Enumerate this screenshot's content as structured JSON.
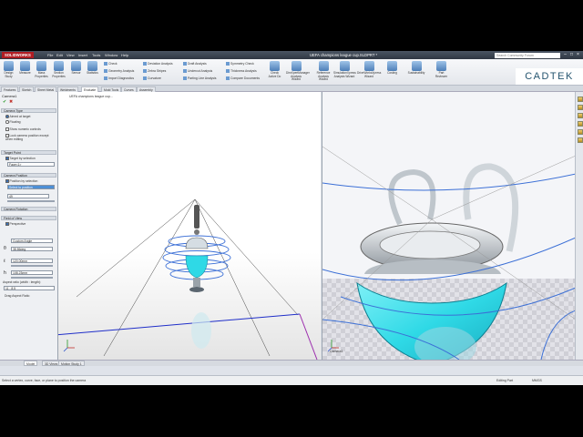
{
  "app": {
    "logo": "SOLIDWORKS",
    "document_title": "UEFA champions league cup.SLDPRT *"
  },
  "menu": [
    "File",
    "Edit",
    "View",
    "Insert",
    "Tools",
    "Window",
    "Help"
  ],
  "search": {
    "placeholder": "Search Community Forum"
  },
  "brand": {
    "logo_text": "CADTEK",
    "accent_color": "#24546f"
  },
  "ribbon": {
    "big_tools": [
      {
        "label": "Design Study",
        "icon": "design-study-icon"
      },
      {
        "label": "Measure",
        "icon": "measure-icon"
      },
      {
        "label": "Mass Properties",
        "icon": "mass-properties-icon"
      },
      {
        "label": "Section Properties",
        "icon": "section-properties-icon"
      },
      {
        "label": "Sensor",
        "icon": "sensor-icon"
      },
      {
        "label": "Statistics",
        "icon": "statistics-icon"
      }
    ],
    "small_tools": [
      [
        "Check",
        "Geometry Analysis",
        "Import Diagnostics"
      ],
      [
        "Deviation Analysis",
        "Zebra Stripes",
        "Curvature"
      ],
      [
        "Draft Analysis",
        "Undercut Analysis",
        "Parting Line Analysis"
      ],
      [
        "Symmetry Check",
        "Thickness Analysis",
        "Compare Documents"
      ]
    ],
    "right_tools": [
      {
        "label": "Check Active Do",
        "icon": "check-active-icon"
      },
      {
        "label": "DimXpertManager Analysis Wizard",
        "icon": "dimxpert-icon"
      },
      {
        "label": "Reference Analysis Wizard",
        "icon": "reference-analysis-icon"
      },
      {
        "label": "SimulationXpress Analysis Wizard",
        "icon": "simulationxpress-icon"
      },
      {
        "label": "DriveWorksXpress Wizard",
        "icon": "driveworks-icon"
      },
      {
        "label": "Costing",
        "icon": "costing-icon"
      },
      {
        "label": "Sustainability",
        "icon": "sustainability-icon"
      },
      {
        "label": "Part Reviewer",
        "icon": "part-reviewer-icon"
      }
    ]
  },
  "command_tabs": [
    "Features",
    "Sketch",
    "Sheet Metal",
    "Weldments",
    "Evaluate",
    "Mold Tools",
    "Curves",
    "Assembly"
  ],
  "active_command_tab": "Evaluate",
  "property_manager": {
    "title": "Camera1",
    "camera_type": {
      "header": "Camera Type",
      "options": [
        {
          "label": "Aimed at target",
          "kind": "radio",
          "on": true
        },
        {
          "label": "Floating",
          "kind": "radio",
          "on": false
        },
        {
          "label": "Show numeric controls",
          "kind": "check",
          "on": false
        },
        {
          "label": "Lock camera position except when editing",
          "kind": "check",
          "on": false
        }
      ]
    },
    "target_point": {
      "header": "Target Point",
      "option": "Target by selection",
      "field": "Face<1>"
    },
    "camera_position": {
      "header": "Camera Position",
      "option": "Position by selection",
      "field": "Select to position",
      "value": "49"
    },
    "camera_rotation": {
      "header": "Camera Rotation"
    },
    "field_of_view": {
      "header": "Field of View",
      "option": "Perspective",
      "dropdown": "Custom Angle",
      "angle": "38.86deg",
      "distance": "120.00mm",
      "height": "108.23mm",
      "aspect_label": "Aspect ratio (width : length):",
      "aspect_value": "11 : 8.5",
      "drag_label": "Drag Aspect Ratio"
    }
  },
  "viewport": {
    "tree_label": "UEFA champions league cup...",
    "right_label": "Camera1"
  },
  "bottom_tabs": [
    "Model",
    "3D Views",
    "Motion Study 1"
  ],
  "active_bottom_tab": "Model",
  "status": {
    "message": "Select a vertex, curve, face, or plane to position the camera",
    "mode": "Editing Part",
    "units": "MMGS"
  },
  "colors": {
    "cup_cyan": "#2fd9e6",
    "plane_line_blue": "#1f2ec9",
    "plane_line_purple": "#9d2fae"
  }
}
